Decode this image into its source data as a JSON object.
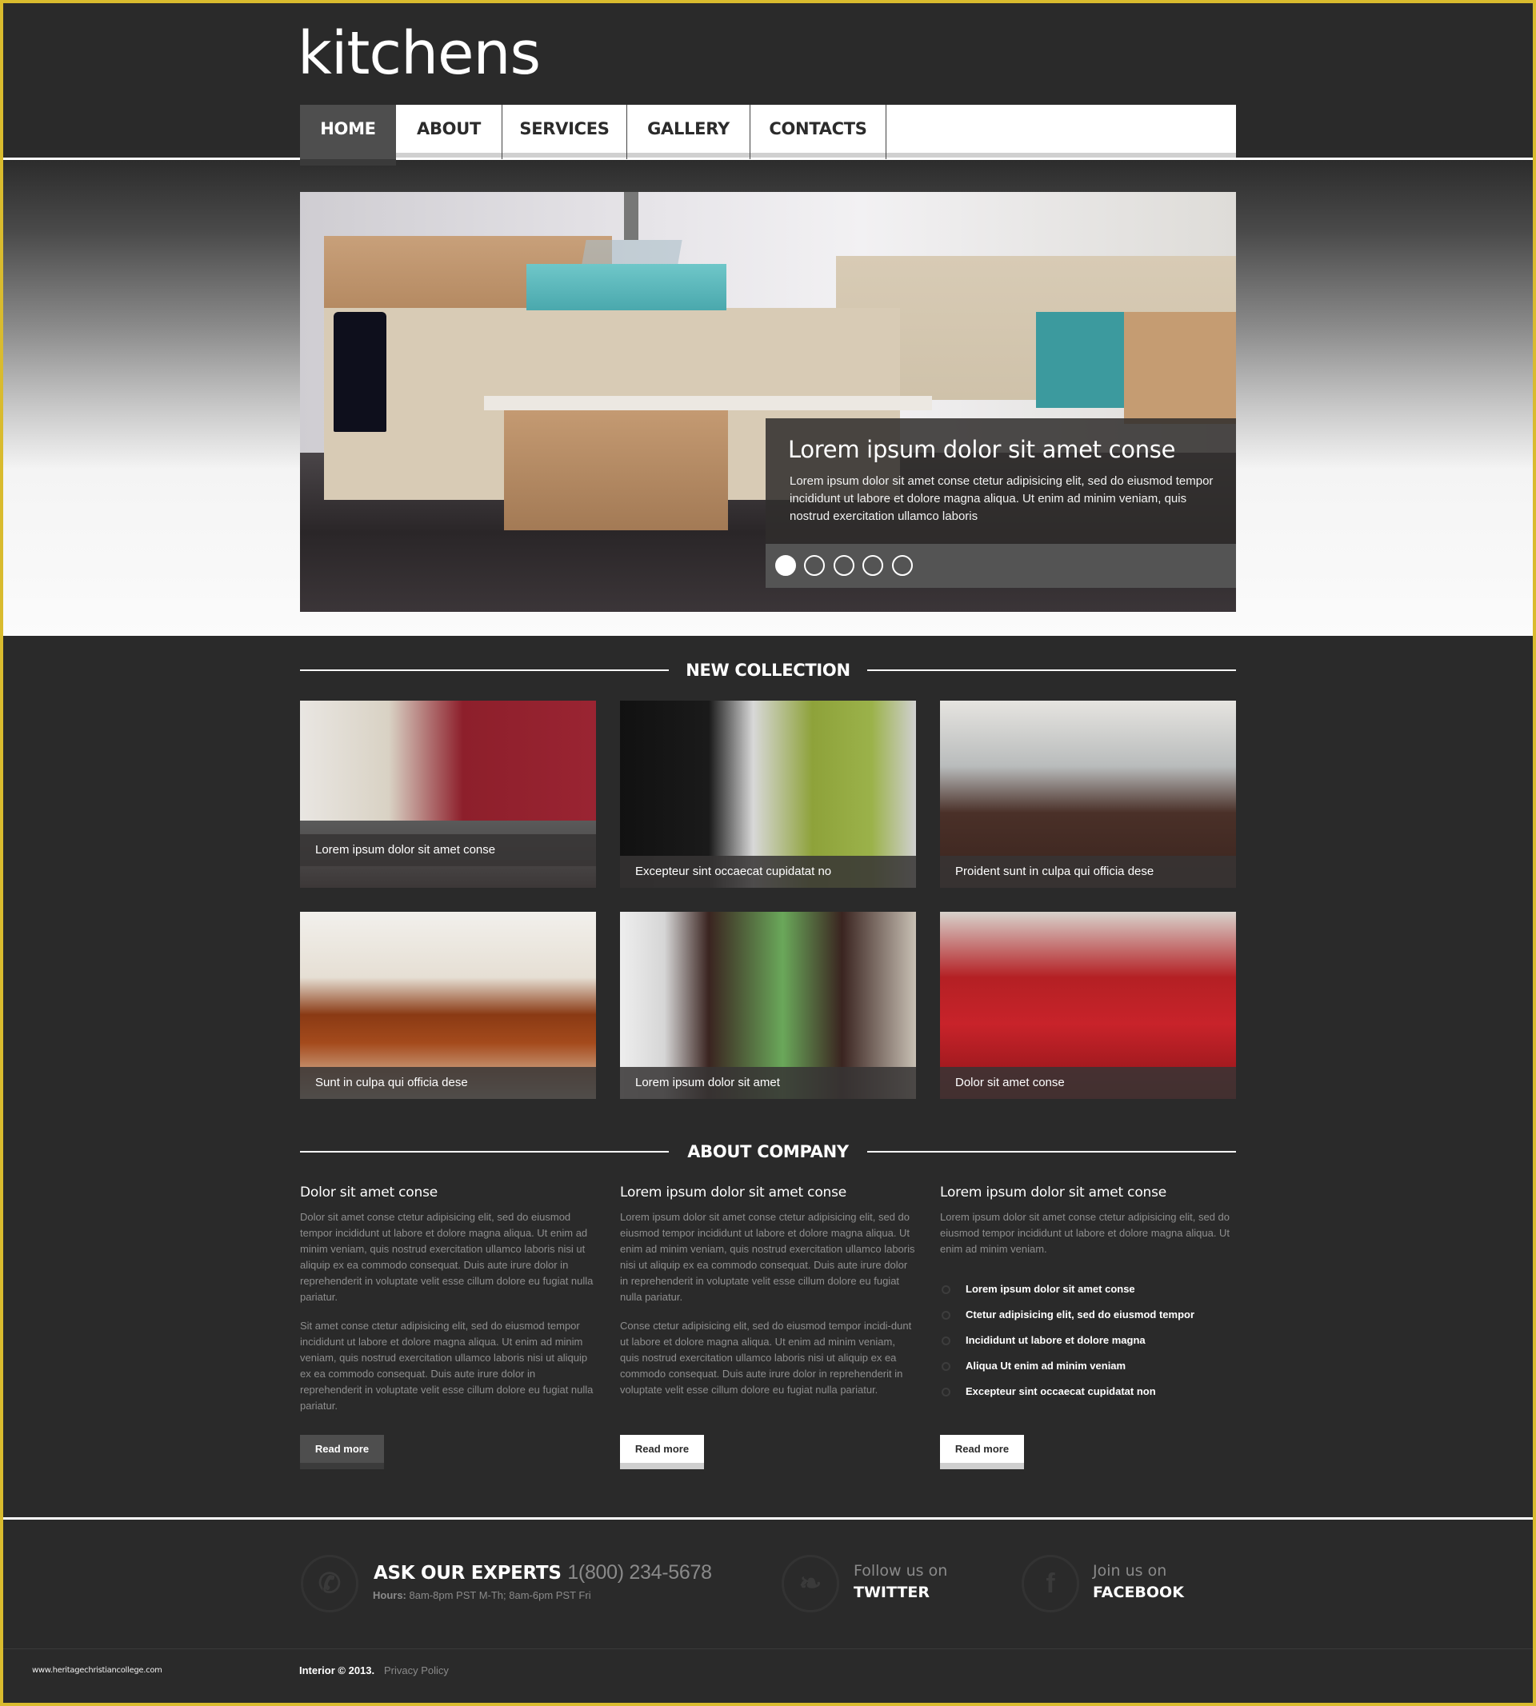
{
  "header": {
    "logo": "kitchens",
    "nav": [
      {
        "label": "HOME",
        "active": true
      },
      {
        "label": "ABOUT",
        "active": false
      },
      {
        "label": "SERVICES",
        "active": false
      },
      {
        "label": "GALLERY",
        "active": false
      },
      {
        "label": "CONTACTS",
        "active": false
      }
    ]
  },
  "slider": {
    "title": "Lorem ipsum dolor sit amet conse",
    "text": "Lorem ipsum dolor sit amet conse ctetur adipisicing elit, sed do eiusmod tempor incididunt ut labore et dolore magna aliqua. Ut enim ad minim veniam, quis nostrud exercitation ullamco laboris",
    "slide_count": 5,
    "active_slide": 1
  },
  "new_collection": {
    "heading": "NEW COLLECTION",
    "items": [
      {
        "caption": "Lorem ipsum dolor sit amet conse"
      },
      {
        "caption": "Excepteur sint occaecat cupidatat no"
      },
      {
        "caption": "Proident sunt in culpa qui officia dese"
      },
      {
        "caption": "Sunt in culpa qui officia dese"
      },
      {
        "caption": "Lorem ipsum dolor sit amet"
      },
      {
        "caption": "Dolor sit amet conse"
      }
    ]
  },
  "about": {
    "heading": "ABOUT COMPANY",
    "columns": [
      {
        "title": "Dolor sit amet conse",
        "paragraphs": [
          "Dolor sit amet conse ctetur adipisicing elit, sed do eiusmod tempor incididunt ut labore et dolore magna aliqua. Ut enim ad minim veniam, quis nostrud exercitation ullamco laboris nisi ut aliquip ex ea commodo consequat. Duis aute irure dolor in reprehenderit in voluptate velit esse cillum dolore eu fugiat nulla pariatur.",
          "Sit amet conse ctetur adipisicing elit, sed do eiusmod tempor incididunt ut labore et dolore magna aliqua. Ut enim ad minim veniam, quis nostrud exercitation ullamco laboris nisi ut aliquip ex ea commodo consequat. Duis aute irure dolor in reprehenderit in voluptate velit esse cillum dolore eu fugiat nulla pariatur."
        ],
        "button": "Read more"
      },
      {
        "title": "Lorem ipsum dolor sit amet conse",
        "paragraphs": [
          "Lorem ipsum dolor sit amet conse ctetur adipisicing elit, sed do eiusmod tempor incididunt ut labore et dolore magna aliqua. Ut enim ad minim veniam, quis nostrud exercitation ullamco laboris nisi ut aliquip ex ea commodo consequat. Duis aute irure dolor in reprehenderit in voluptate velit esse cillum dolore eu fugiat nulla pariatur.",
          "Conse ctetur adipisicing elit, sed do eiusmod tempor incidi-dunt ut labore et dolore magna aliqua. Ut enim ad minim veniam, quis nostrud exercitation ullamco laboris nisi ut aliquip ex ea commodo consequat. Duis aute irure dolor in reprehenderit in voluptate velit esse cillum dolore eu fugiat nulla pariatur."
        ],
        "button": "Read more"
      },
      {
        "title": "Lorem ipsum dolor sit amet conse",
        "paragraphs": [
          "Lorem ipsum dolor sit amet conse ctetur adipisicing elit, sed do eiusmod tempor incididunt ut labore et dolore magna aliqua. Ut enim ad minim veniam."
        ],
        "list": [
          "Lorem ipsum dolor sit amet conse",
          "Ctetur adipisicing elit, sed do eiusmod tempor",
          "Incididunt ut labore et dolore magna",
          "Aliqua Ut enim ad minim veniam",
          "Excepteur sint occaecat cupidatat non"
        ],
        "button": "Read more"
      }
    ]
  },
  "footer": {
    "experts_label": "ASK OUR EXPERTS",
    "phone": "1(800) 234-5678",
    "hours_label": "Hours:",
    "hours": "8am-8pm PST M-Th;  8am-6pm PST Fri",
    "twitter_small": "Follow us on",
    "twitter_big": "TWITTER",
    "facebook_small": "Join us on",
    "facebook_big": "FACEBOOK",
    "copyright": "Interior © 2013.",
    "privacy": "Privacy Policy",
    "watermark": "www.heritagechristiancollege.com"
  },
  "colors": {
    "frame": "#d9bb2e",
    "background": "#2a2a2a",
    "nav_active": "#4e4e4e"
  }
}
